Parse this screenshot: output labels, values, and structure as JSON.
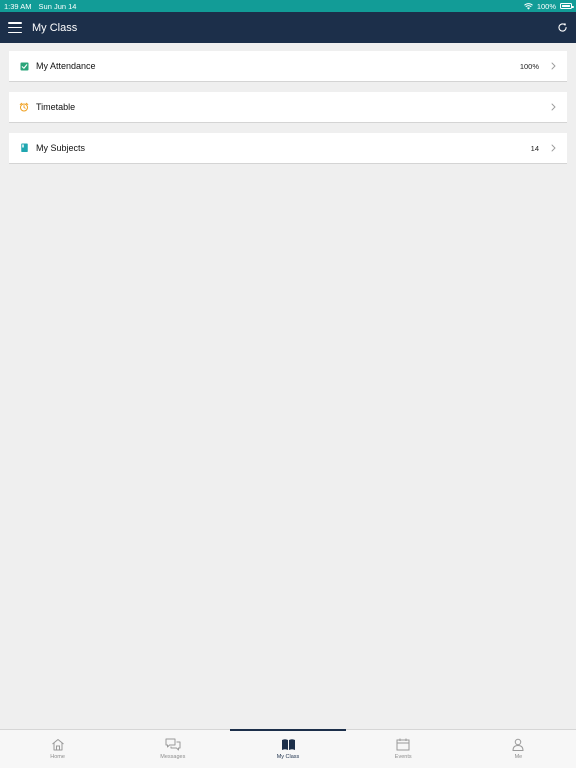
{
  "status_bar": {
    "time": "1:39 AM",
    "date": "Sun Jun 14",
    "battery": "100%",
    "battery_level": 1.0
  },
  "header": {
    "title": "My Class"
  },
  "items": [
    {
      "label": "My Attendance",
      "value": "100%",
      "icon": "check-square-icon",
      "icon_color": "#2aa57a"
    },
    {
      "label": "Timetable",
      "value": "",
      "icon": "alarm-clock-icon",
      "icon_color": "#f0a020"
    },
    {
      "label": "My Subjects",
      "value": "14",
      "icon": "book-icon",
      "icon_color": "#20a6b0"
    }
  ],
  "tabs": [
    {
      "label": "Home",
      "icon": "home-icon",
      "active": false
    },
    {
      "label": "Messages",
      "icon": "chat-bubbles-icon",
      "active": false
    },
    {
      "label": "My Class",
      "icon": "open-book-icon",
      "active": true
    },
    {
      "label": "Events",
      "icon": "calendar-icon",
      "active": false
    },
    {
      "label": "Me",
      "icon": "person-icon",
      "active": false
    }
  ],
  "colors": {
    "status_bar": "#129c97",
    "nav_bar": "#1c2f4a",
    "background": "#efefef"
  }
}
